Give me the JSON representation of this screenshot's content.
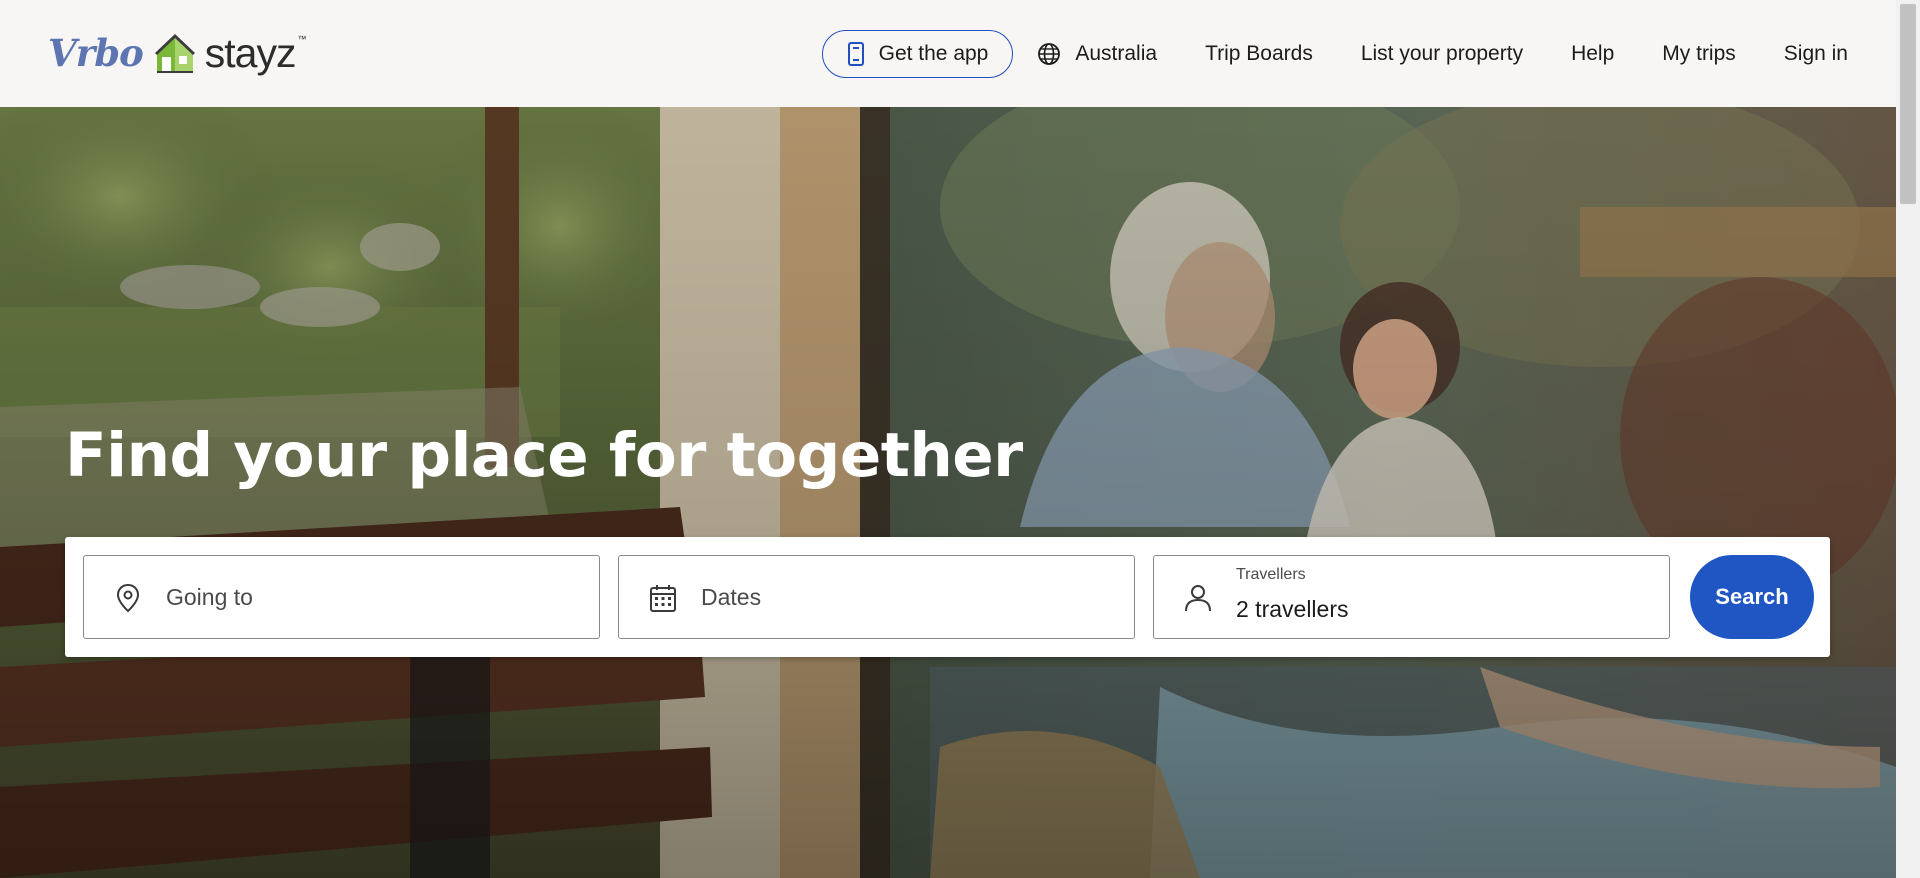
{
  "brand": {
    "vrbo": "Vrbo",
    "stayz": "stayz",
    "tm": "™"
  },
  "nav": {
    "get_app": "Get the app",
    "region": "Australia",
    "trip_boards": "Trip Boards",
    "list_property": "List your property",
    "help": "Help",
    "my_trips": "My trips",
    "sign_in": "Sign in"
  },
  "hero": {
    "title": "Find your place for together"
  },
  "search": {
    "going_to_placeholder": "Going to",
    "dates_placeholder": "Dates",
    "travellers_label": "Travellers",
    "travellers_value": "2 travellers",
    "search_label": "Search"
  },
  "colors": {
    "accent": "#1f56c4",
    "header_bg": "#f7f6f4",
    "text": "#1c1c1c"
  },
  "icons": {
    "get_app": "phone-icon",
    "region": "globe-icon",
    "going_to": "map-pin-icon",
    "dates": "calendar-icon",
    "travellers": "person-icon"
  }
}
